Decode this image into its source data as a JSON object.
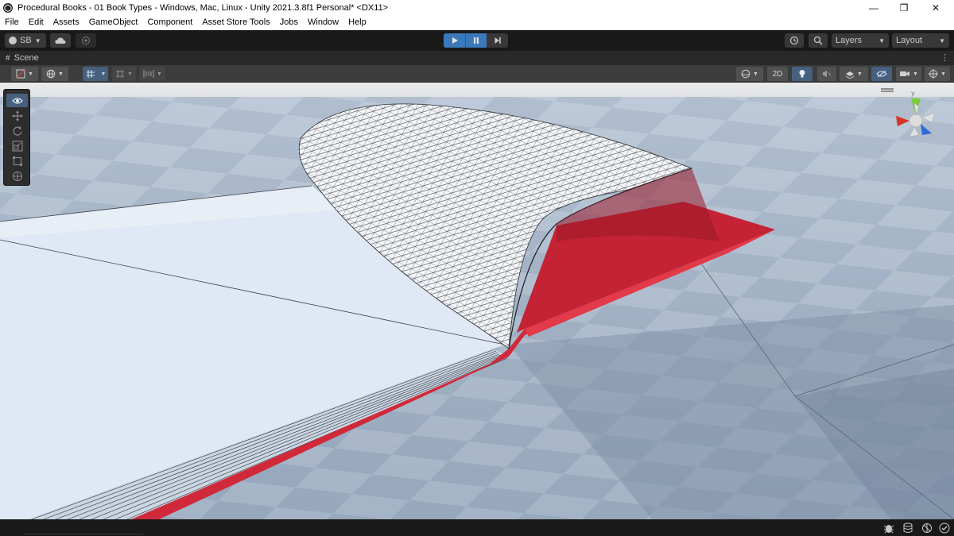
{
  "window": {
    "title": "Procedural Books - 01 Book Types - Windows, Mac, Linux - Unity 2021.3.8f1 Personal* <DX11>",
    "minimize": "—",
    "restore": "❐",
    "close": "✕"
  },
  "menu": {
    "items": [
      "File",
      "Edit",
      "Assets",
      "GameObject",
      "Component",
      "Asset Store Tools",
      "Jobs",
      "Window",
      "Help"
    ]
  },
  "toolbar": {
    "account_label": "SB",
    "layers_label": "Layers",
    "layout_label": "Layout"
  },
  "scene": {
    "tab_label": "Scene",
    "mode_2d": "2D"
  },
  "colors": {
    "accent_blue": "#3a79bb",
    "book_red": "#d02a3a",
    "page_white": "#dfe8f4"
  }
}
